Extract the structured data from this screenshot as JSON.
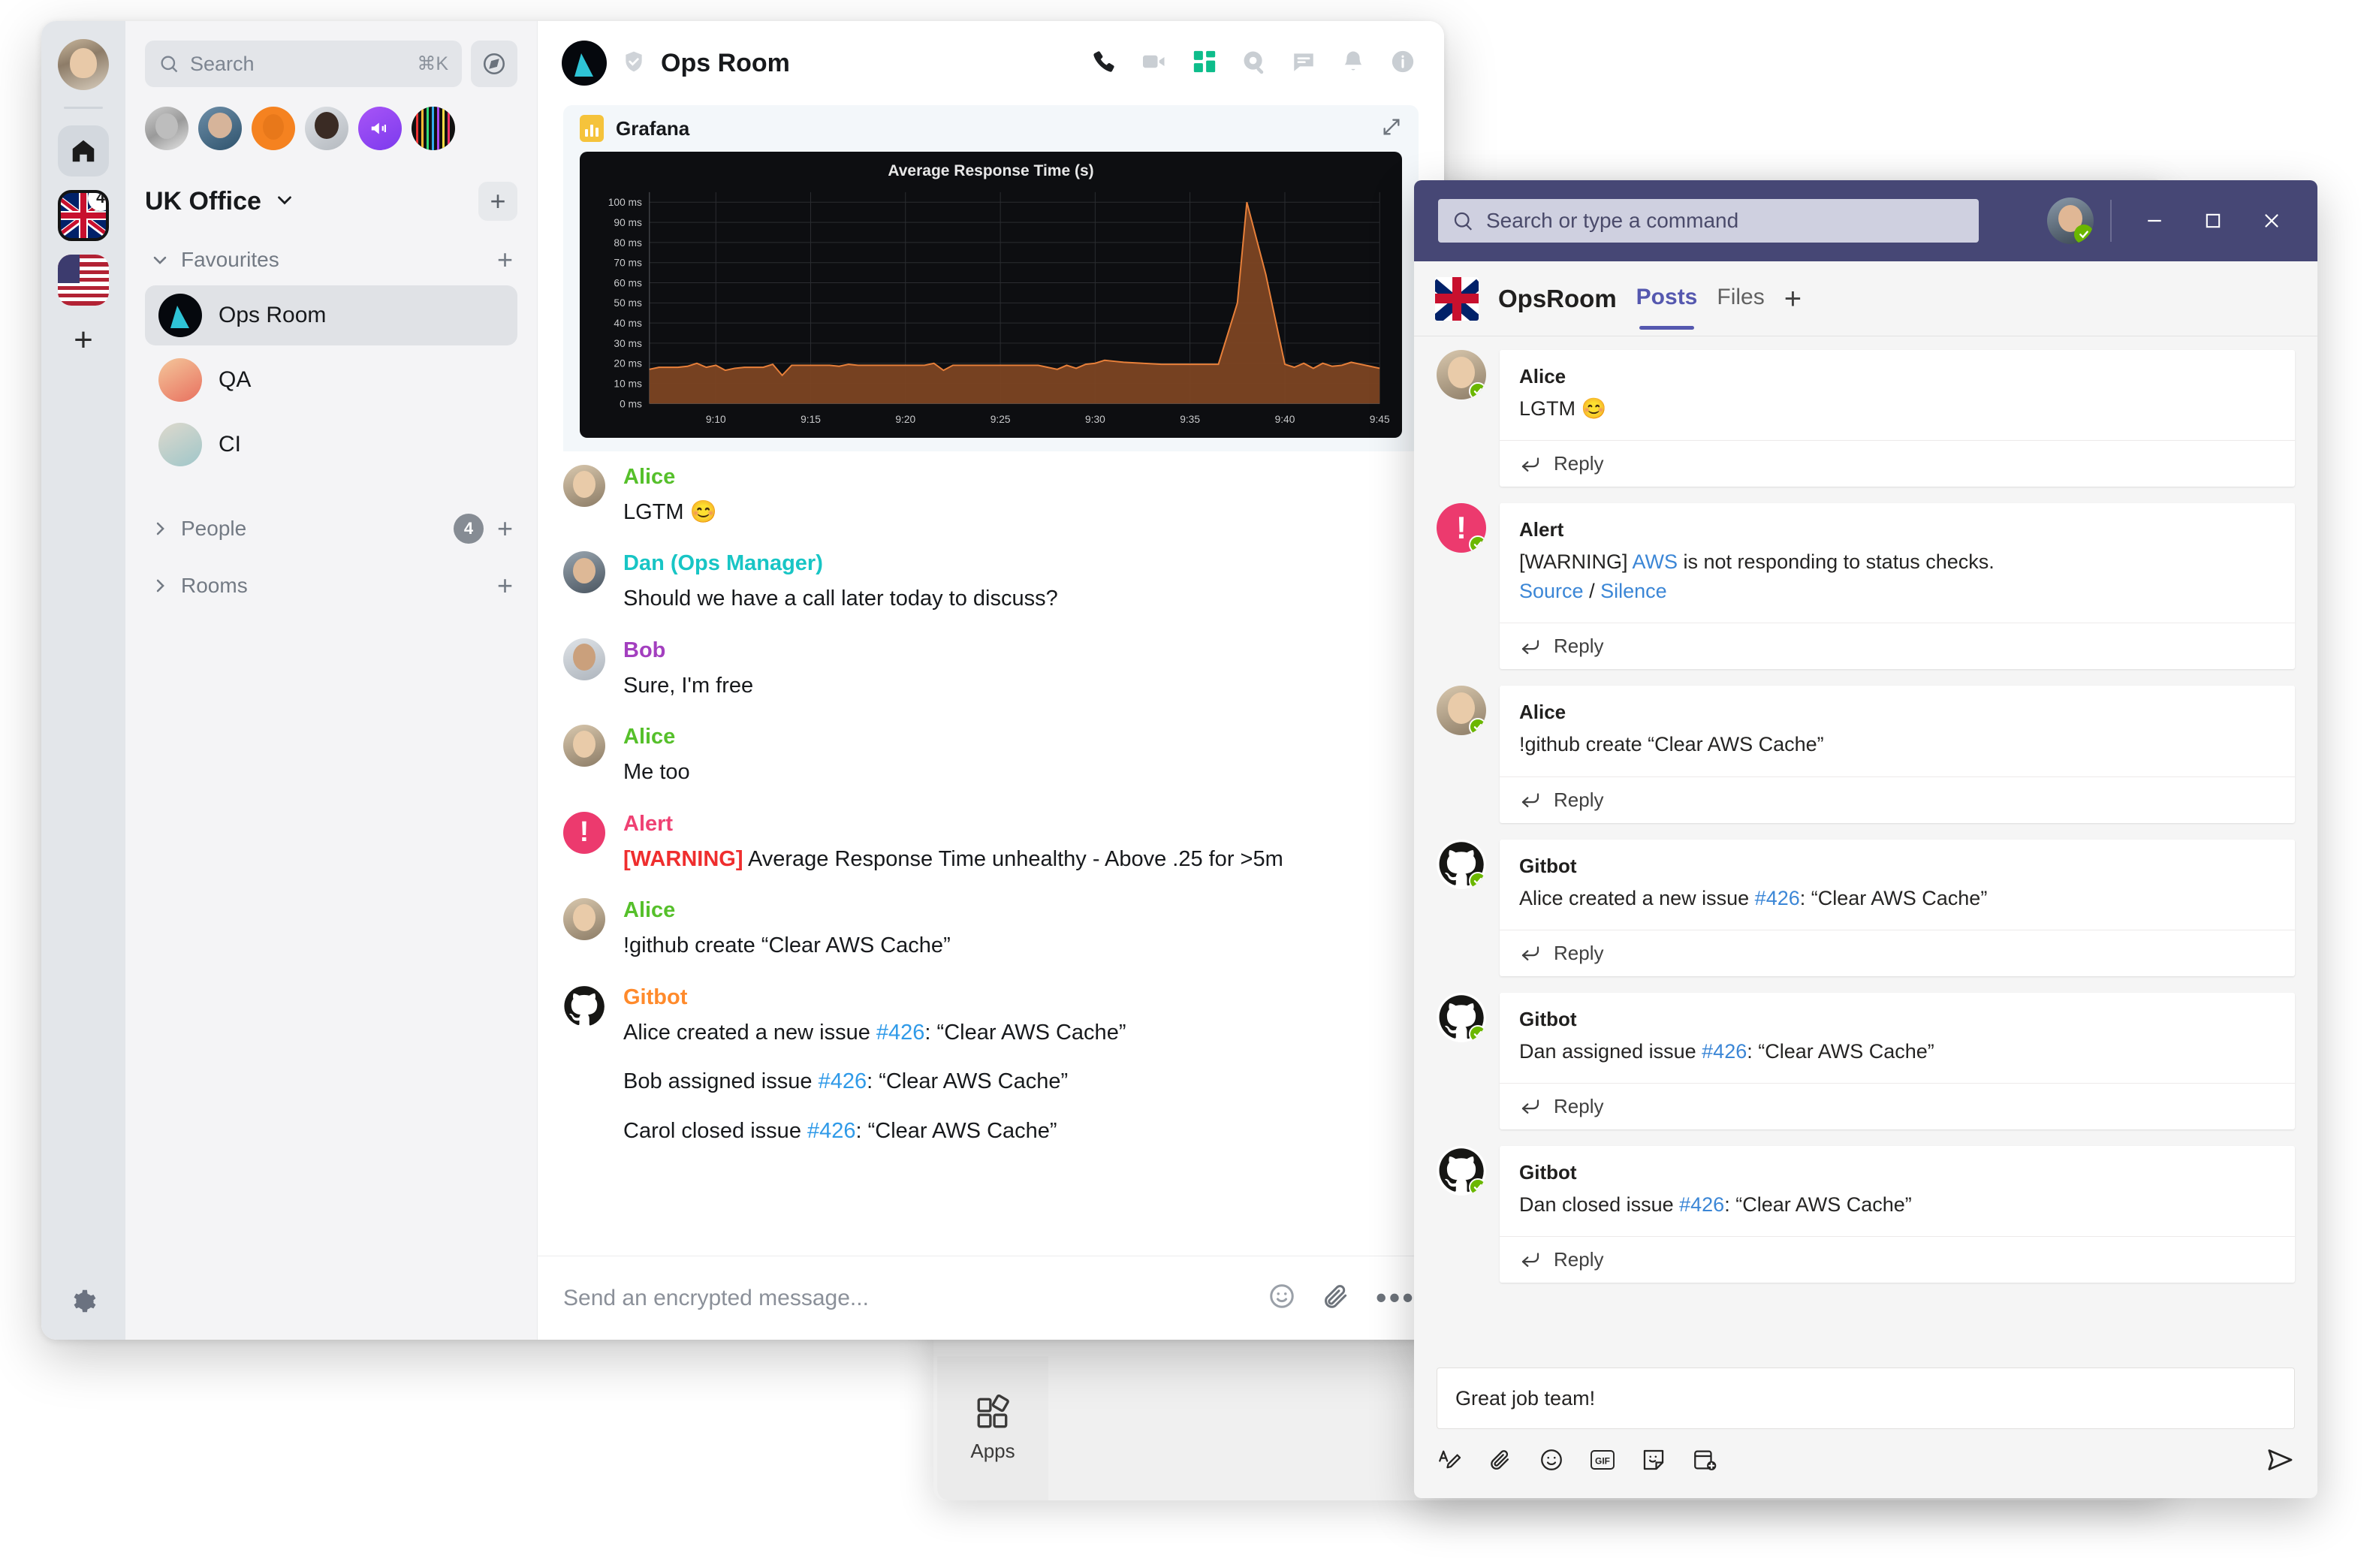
{
  "element_app": {
    "rail": {
      "user_avatar": "user-avatar",
      "home_label": "Home",
      "uk_space_badge": "4",
      "add_space_label": "+",
      "settings_label": "Settings"
    },
    "search": {
      "placeholder": "Search",
      "shortcut": "⌘K"
    },
    "explore_label": "Explore",
    "space": {
      "title": "UK Office",
      "add_label": "+"
    },
    "sections": [
      {
        "name": "Favourites",
        "expanded": true,
        "add_label": "+"
      },
      {
        "name": "People",
        "expanded": false,
        "badge": "4",
        "add_label": "+"
      },
      {
        "name": "Rooms",
        "expanded": false,
        "add_label": "+"
      }
    ],
    "rooms": [
      {
        "name": "Ops Room",
        "active": true
      },
      {
        "name": "QA",
        "active": false
      },
      {
        "name": "CI",
        "active": false
      }
    ],
    "chat": {
      "title": "Ops Room",
      "verified": true,
      "header_icons": [
        "call-icon",
        "video-icon",
        "apps-grid-icon",
        "search-icon",
        "threads-icon",
        "notifications-icon",
        "room-info-icon"
      ],
      "widget": {
        "name": "Grafana",
        "expand_label": "Expand"
      },
      "messages": [
        {
          "sender": "Alice",
          "color": "#56c02b",
          "avatar": "alice",
          "lines": [
            "LGTM 😊"
          ]
        },
        {
          "sender": "Dan (Ops Manager)",
          "color": "#18c5c5",
          "avatar": "dan",
          "lines": [
            "Should we have a call later today to discuss?"
          ]
        },
        {
          "sender": "Bob",
          "color": "#a33fbf",
          "avatar": "bob",
          "lines": [
            "Sure, I'm free"
          ]
        },
        {
          "sender": "Alice",
          "color": "#56c02b",
          "avatar": "alice",
          "lines": [
            "Me too"
          ]
        },
        {
          "sender": "Alert",
          "color": "#ef4173",
          "avatar": "alert",
          "lines": [
            "[WARNING] Average Response Time unhealthy - Above .25 for >5m"
          ],
          "warning_prefix": "[WARNING]",
          "warning_rest": " Average Response Time unhealthy - Above .25 for >5m"
        },
        {
          "sender": "Alice",
          "color": "#56c02b",
          "avatar": "alice",
          "lines": [
            "!github create “Clear AWS Cache”"
          ]
        },
        {
          "sender": "Gitbot",
          "color": "#ff8a2b",
          "avatar": "github",
          "lines": [
            "Alice created a new issue #426: “Clear AWS Cache”",
            "Bob assigned issue #426: “Clear AWS Cache”",
            "Carol closed issue #426: “Clear AWS Cache”"
          ]
        }
      ],
      "gitbot_lines": [
        {
          "pre": "Alice created a new issue ",
          "issue": "#426",
          "post": ": “Clear AWS Cache”"
        },
        {
          "pre": "Bob assigned issue ",
          "issue": "#426",
          "post": ": “Clear AWS Cache”"
        },
        {
          "pre": "Carol closed issue ",
          "issue": "#426",
          "post": ": “Clear AWS Cache”"
        }
      ],
      "composer": {
        "placeholder": "Send an encrypted message...",
        "icons": [
          "emoji-icon",
          "attachment-icon",
          "more-options-icon"
        ]
      }
    }
  },
  "chart_data": {
    "type": "area",
    "title": "Average Response Time (s)",
    "xlabel": "",
    "ylabel": "",
    "ylim": [
      0,
      105
    ],
    "ytick_labels": [
      "0 ms",
      "10 ms",
      "20 ms",
      "30 ms",
      "40 ms",
      "50 ms",
      "60 ms",
      "70 ms",
      "80 ms",
      "90 ms",
      "100 ms"
    ],
    "ytick_values": [
      0,
      10,
      20,
      30,
      40,
      50,
      60,
      70,
      80,
      90,
      100
    ],
    "xtick_labels": [
      "9:10",
      "9:15",
      "9:20",
      "9:25",
      "9:30",
      "9:35",
      "9:40",
      "9:45"
    ],
    "xtick_values": [
      9.1667,
      9.25,
      9.3333,
      9.4167,
      9.5,
      9.5833,
      9.6667,
      9.75
    ],
    "grid": true,
    "line_color": "#e8803a",
    "fill_color": "#7c4423",
    "background": "#0d0e11",
    "x": [
      9.1083,
      9.1167,
      9.125,
      9.1333,
      9.1417,
      9.15,
      9.1583,
      9.1667,
      9.175,
      9.1833,
      9.1917,
      9.2,
      9.2083,
      9.2167,
      9.225,
      9.2333,
      9.2417,
      9.25,
      9.2583,
      9.2667,
      9.275,
      9.2833,
      9.2917,
      9.3,
      9.3083,
      9.3167,
      9.325,
      9.3333,
      9.3417,
      9.35,
      9.3583,
      9.3667,
      9.375,
      9.3833,
      9.3917,
      9.4,
      9.4083,
      9.4167,
      9.425,
      9.4333,
      9.4417,
      9.45,
      9.4583,
      9.4667,
      9.475,
      9.4833,
      9.4917,
      9.5,
      9.5083,
      9.5167,
      9.525,
      9.5417,
      9.5583,
      9.575,
      9.5917,
      9.6083,
      9.625,
      9.6333,
      9.65,
      9.6667,
      9.675,
      9.6833,
      9.6917,
      9.7,
      9.7083,
      9.7167,
      9.725,
      9.7333,
      9.7417,
      9.75
    ],
    "y": [
      17,
      18,
      18,
      18,
      18.5,
      20,
      18,
      19,
      16.5,
      17.5,
      18,
      18,
      18,
      19.5,
      14,
      19,
      19,
      19,
      19,
      19,
      18.5,
      19.5,
      19,
      19,
      19,
      19,
      19,
      19,
      19,
      19,
      20,
      16.5,
      19,
      19,
      19,
      19,
      19,
      19,
      19,
      19,
      19,
      19,
      18,
      17,
      19,
      17.5,
      19.5,
      20,
      21.5,
      21,
      20.5,
      20,
      19.5,
      19.5,
      19.5,
      19.5,
      50,
      100,
      64,
      19.5,
      18,
      20,
      17.5,
      20,
      18.5,
      19,
      20.5,
      19.5,
      18.5,
      17.5
    ],
    "annotations": [
      "Spike to ~100 ms around 9:40"
    ]
  },
  "teams_app": {
    "titlebar": {
      "search_placeholder": "Search or type a command",
      "minimize_label": "Minimize",
      "maximize_label": "Maximize",
      "close_label": "Close",
      "bar_color": "#464775"
    },
    "channel": {
      "name": "OpsRoom",
      "flag": "uk-flag-icon"
    },
    "tabs": [
      {
        "label": "Posts",
        "active": true
      },
      {
        "label": "Files",
        "active": false
      }
    ],
    "add_tab_label": "+",
    "posts": [
      {
        "sender": "Alice",
        "avatar": "alice",
        "text": "LGTM 😊",
        "reply_label": "Reply"
      },
      {
        "sender": "Alert",
        "avatar": "alert",
        "text_pre": "[WARNING] ",
        "link": "AWS",
        "text_post": " is not responding to status checks.",
        "source_label": "Source",
        "separator": " / ",
        "silence_label": "Silence",
        "reply_label": "Reply"
      },
      {
        "sender": "Alice",
        "avatar": "alice",
        "text": "!github create “Clear AWS Cache”",
        "reply_label": "Reply"
      },
      {
        "sender": "Gitbot",
        "avatar": "github",
        "text_pre": "Alice created a new issue ",
        "issue": "#426",
        "text_post": ": “Clear AWS Cache”",
        "reply_label": "Reply"
      },
      {
        "sender": "Gitbot",
        "avatar": "github",
        "text_pre": "Dan assigned issue ",
        "issue": "#426",
        "text_post": ": “Clear AWS Cache”",
        "reply_label": "Reply"
      },
      {
        "sender": "Gitbot",
        "avatar": "github",
        "text_pre": "Dan closed issue ",
        "issue": "#426",
        "text_post": ": “Clear AWS Cache”",
        "reply_label": "Reply"
      }
    ],
    "compose": {
      "value": "Great job team!",
      "tools": [
        "format-icon",
        "attach-icon",
        "emoji-icon",
        "gif-icon",
        "sticker-icon",
        "meeting-icon"
      ],
      "send_label": "Send"
    }
  },
  "background_window": {
    "apps_label": "Apps",
    "filter_icon": "filter-icon",
    "add_icon": "add-icon",
    "overflow_icon": "more-icon"
  }
}
